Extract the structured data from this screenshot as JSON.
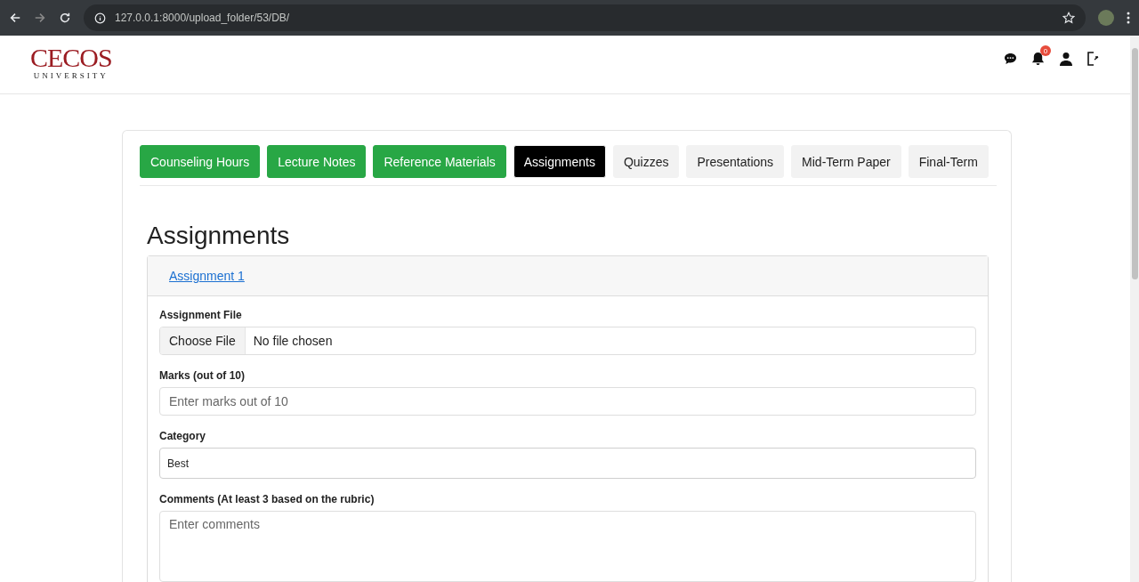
{
  "browser": {
    "url": "127.0.0.1:8000/upload_folder/53/DB/"
  },
  "header": {
    "logo_title": "CECOS",
    "logo_subtitle": "UNIVERSITY",
    "notification_count": "0"
  },
  "tabs": [
    {
      "label": "Counseling Hours",
      "kind": "done",
      "selected": false
    },
    {
      "label": "Lecture Notes",
      "kind": "done",
      "selected": false
    },
    {
      "label": "Reference Materials",
      "kind": "done",
      "selected": false
    },
    {
      "label": "Assignments",
      "kind": "pending",
      "selected": true
    },
    {
      "label": "Quizzes",
      "kind": "pending",
      "selected": false
    },
    {
      "label": "Presentations",
      "kind": "pending",
      "selected": false
    },
    {
      "label": "Mid-Term Paper",
      "kind": "pending",
      "selected": false
    },
    {
      "label": "Final-Term",
      "kind": "pending",
      "selected": false
    }
  ],
  "section_title": "Assignments",
  "accordion": {
    "title": "Assignment 1",
    "fields": [
      {
        "kind": "file",
        "label": "Assignment File",
        "button": "Choose File",
        "value": "No file chosen"
      },
      {
        "kind": "input",
        "label": "Marks (out of 10)",
        "placeholder": "Enter marks out of 10"
      },
      {
        "kind": "select",
        "label": "Category",
        "value": "Best"
      },
      {
        "kind": "textarea",
        "label": "Comments (At least 3 based on the rubric)",
        "placeholder": "Enter comments"
      }
    ]
  }
}
